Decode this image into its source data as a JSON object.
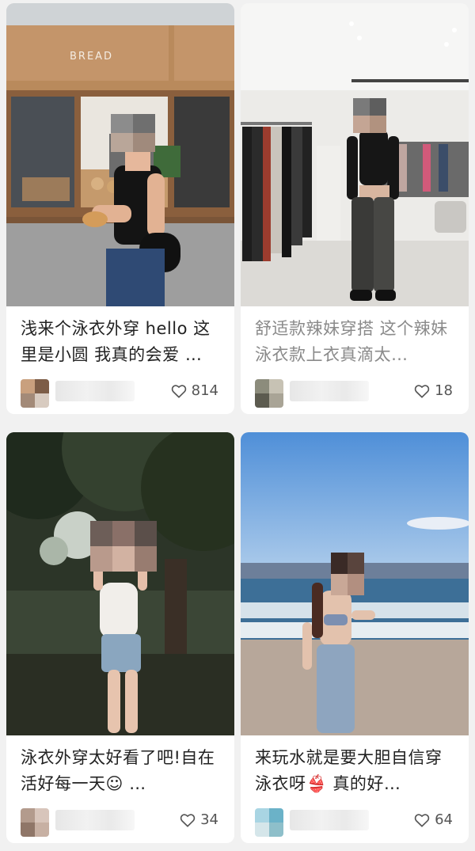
{
  "cards": [
    {
      "caption": "浅来个泳衣外穿 hello 这里是小圆 我真的会爱 …",
      "likes": "814",
      "photo": "photo of woman in black top holding bread in front of a bakery shop with BREAD sign",
      "sign_text": "BREAD"
    },
    {
      "caption": "舒适款辣妹穿搭 这个辣妹泳衣款上衣真滴太…",
      "likes": "18",
      "photo": "photo of woman in black crop top and leather pants in clothing store"
    },
    {
      "caption": "泳衣外穿太好看了吧!自在活好每一天☺ …",
      "likes": "34",
      "photo": "photo of woman in white bodysuit and denim shorts under trees"
    },
    {
      "caption": "来玩水就是要大胆自信穿泳衣呀👙 真的好…",
      "likes": "64",
      "photo": "photo of woman in bikini top and jeans on a beach"
    }
  ],
  "colors": {
    "background": "#f1f1f1",
    "card": "#ffffff",
    "text": "#222222",
    "muted_text": "#8a8a8a",
    "like_text": "#555555"
  },
  "icons": {
    "like": "heart-outline-icon"
  }
}
